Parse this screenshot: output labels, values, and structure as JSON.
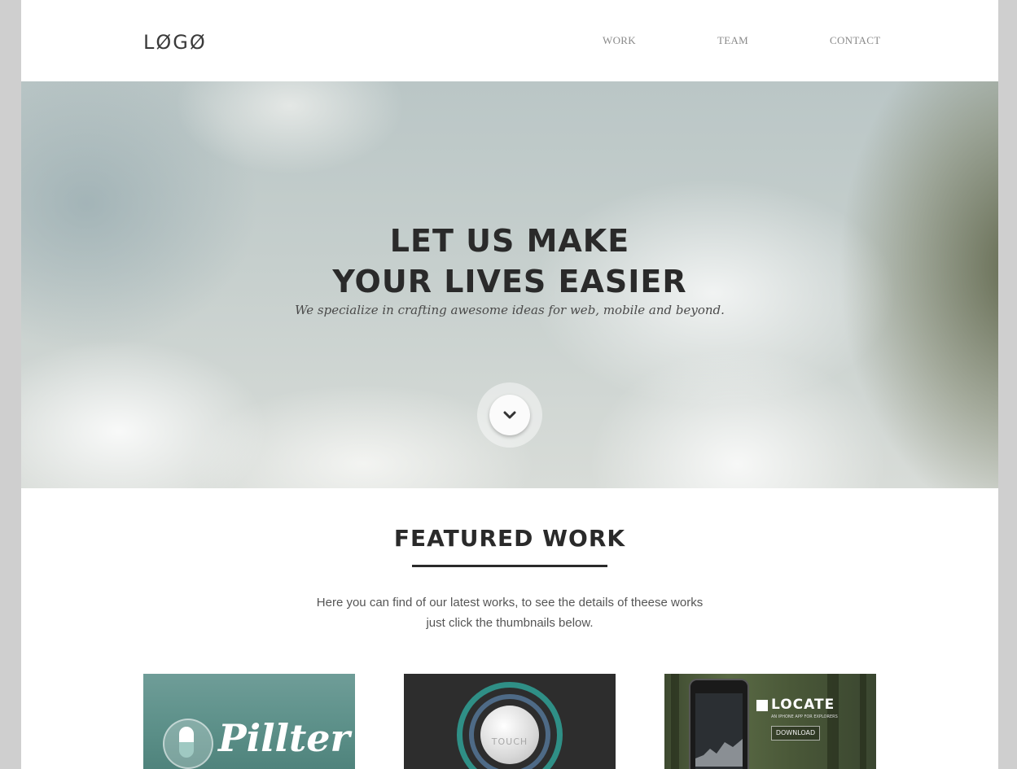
{
  "header": {
    "logo": "LØGØ",
    "nav": [
      "WORK",
      "TEAM",
      "CONTACT"
    ]
  },
  "hero": {
    "title_line1": "LET US MAKE",
    "title_line2": "YOUR LIVES EASIER",
    "subtitle": "We specialize in crafting awesome ideas for web, mobile and beyond."
  },
  "featured": {
    "title": "FEATURED WORK",
    "description_line1": "Here you can find of our latest works, to see the details of theese works",
    "description_line2": "just click the thumbnails below.",
    "thumbnails": [
      {
        "label": "Pillter"
      },
      {
        "label": "TOUCH"
      },
      {
        "label": "LOCATE",
        "tagline": "AN IPHONE APP FOR EXPLORERS",
        "button": "DOWNLOAD"
      }
    ]
  },
  "colors": {
    "text_dark": "#2a2a2a",
    "nav_gray": "#8a8a8a",
    "page_bg": "#cfcfcf"
  }
}
